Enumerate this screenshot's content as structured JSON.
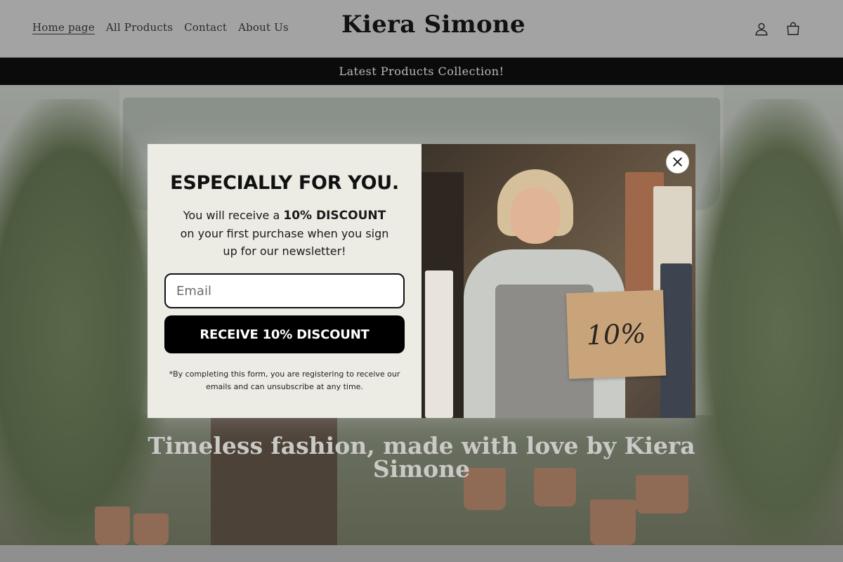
{
  "header": {
    "nav": [
      {
        "label": "Home page",
        "active": true
      },
      {
        "label": "All Products",
        "active": false
      },
      {
        "label": "Contact",
        "active": false
      },
      {
        "label": "About Us",
        "active": false
      }
    ],
    "logo": "Kiera Simone",
    "icons": {
      "account": "user-icon",
      "cart": "cart-icon"
    }
  },
  "announcement": {
    "text": "Latest Products Collection!"
  },
  "hero": {
    "title": "Timeless fashion, made with love by Kiera Simone"
  },
  "popup": {
    "heading": "ESPECIALLY FOR YOU.",
    "text_before": "You will receive a",
    "text_bold": "10% DISCOUNT",
    "text_after": "on your first purchase when you sign up for our newsletter!",
    "email_placeholder": "Email",
    "email_value": "",
    "button_label": "RECEIVE 10% DISCOUNT",
    "disclaimer": "*By completing this form, you are registering to receive our emails and can unsubscribe at any time.",
    "image_sign_text": "10%",
    "close_icon": "close-icon"
  },
  "colors": {
    "announcement_bg": "#0b0b0b",
    "button_bg": "#000000",
    "popup_bg": "#ecebe4"
  }
}
